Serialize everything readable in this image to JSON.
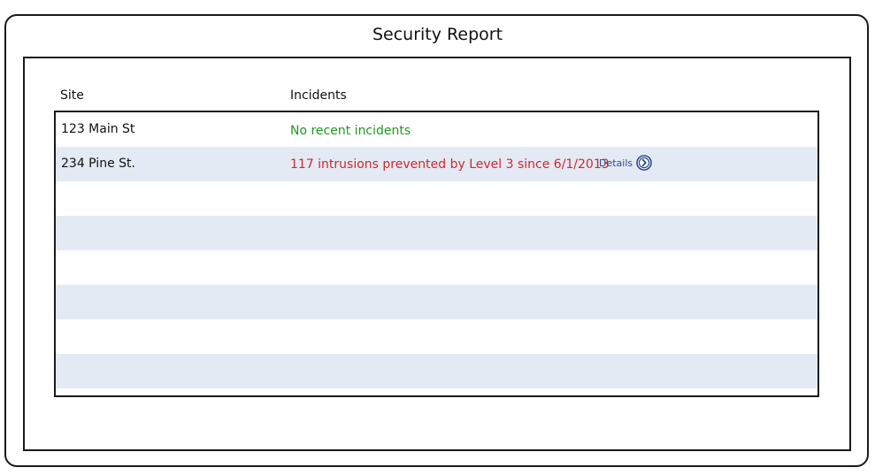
{
  "window": {
    "title": "Security Report"
  },
  "table": {
    "headers": {
      "site": "Site",
      "incidents": "Incidents"
    },
    "rows": [
      {
        "site": "123 Main St",
        "incident": "No recent incidents",
        "status": "ok"
      },
      {
        "site": "234 Pine St.",
        "incident": "117 intrusions prevented by Level 3 since 6/1/2013",
        "status": "alert",
        "action_label": "Details",
        "action_icon": "chevron-right-circle-icon"
      }
    ]
  },
  "colors": {
    "ok": "#1e9a1e",
    "alert": "#d0282e",
    "link": "#2a4a8c",
    "row_alt": "#e4eaf4"
  }
}
